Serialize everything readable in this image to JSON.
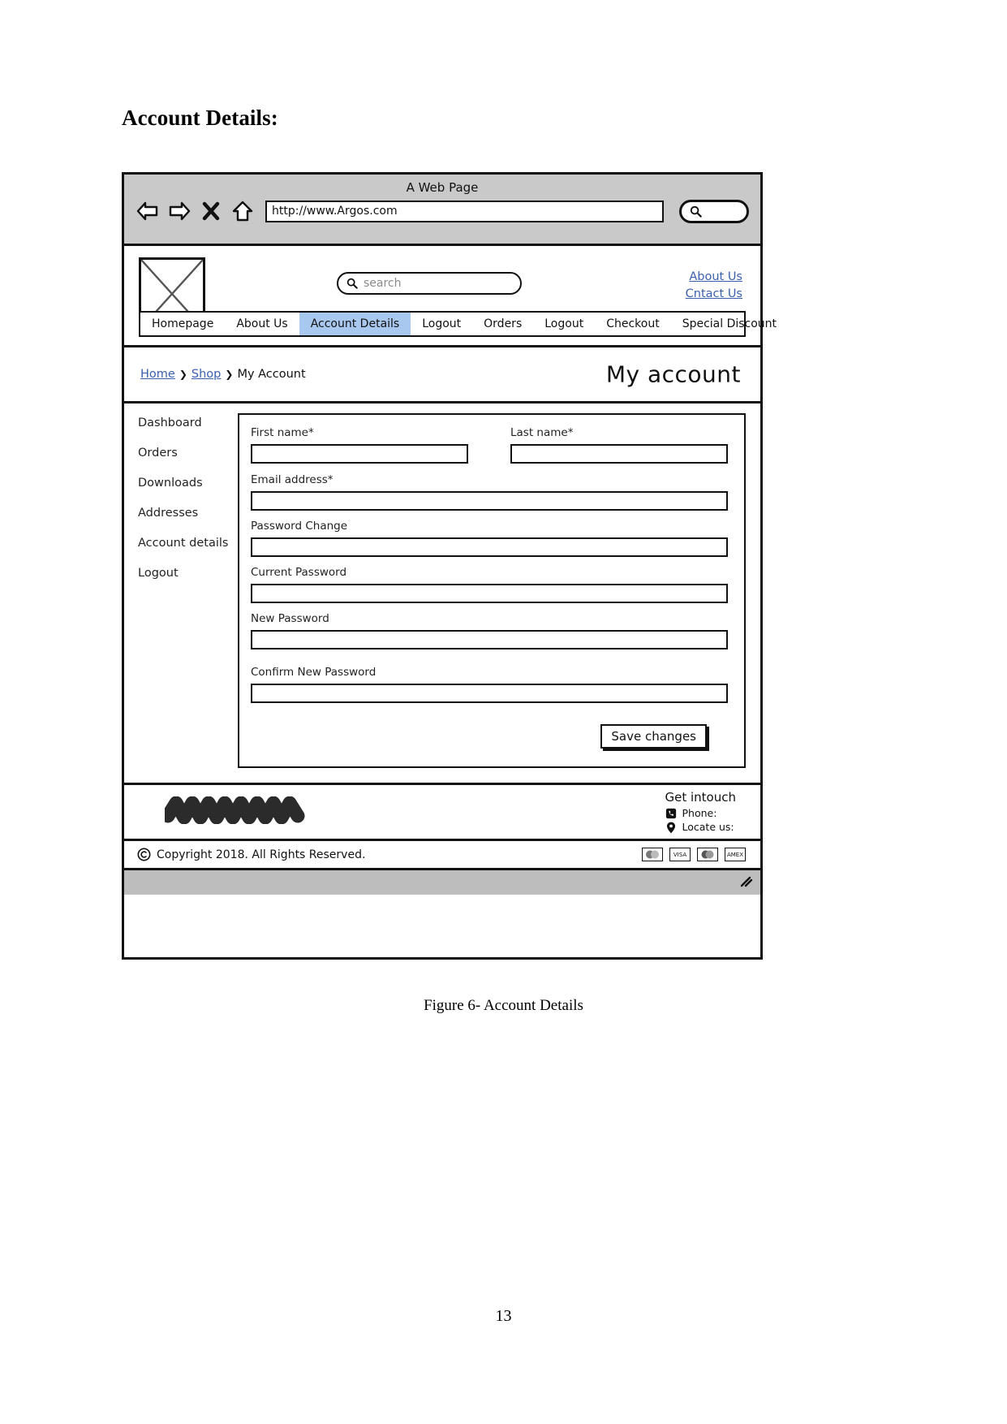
{
  "document": {
    "heading": "Account Details:",
    "figure_caption": "Figure 6- Account Details",
    "page_number": "13"
  },
  "browser": {
    "window_title": "A Web Page",
    "url": "http://www.Argos.com",
    "icons": {
      "back": "back-arrow-icon",
      "forward": "forward-arrow-icon",
      "stop": "close-x-icon",
      "home": "home-icon",
      "search": "search-icon"
    }
  },
  "site_header": {
    "logo_alt": "logo-placeholder",
    "search_placeholder": "search",
    "links": [
      {
        "label": "About Us"
      },
      {
        "label": "Cntact Us"
      }
    ]
  },
  "nav": {
    "items": [
      {
        "label": "Homepage",
        "active": false
      },
      {
        "label": "About Us",
        "active": false
      },
      {
        "label": "Account Details",
        "active": true
      },
      {
        "label": "Logout",
        "active": false
      },
      {
        "label": "Orders",
        "active": false
      },
      {
        "label": "Logout",
        "active": false
      },
      {
        "label": "Checkout",
        "active": false
      },
      {
        "label": "Special Discount",
        "active": false
      }
    ],
    "active_color": "#a8c8f0"
  },
  "breadcrumb": {
    "home": "Home",
    "shop": "Shop",
    "current": "My Account",
    "separator": "❯"
  },
  "page": {
    "title": "My account"
  },
  "sidebar": {
    "items": [
      {
        "label": "Dashboard"
      },
      {
        "label": "Orders"
      },
      {
        "label": "Downloads"
      },
      {
        "label": "Addresses"
      },
      {
        "label": "Account details"
      },
      {
        "label": "Logout"
      }
    ]
  },
  "form": {
    "first_name_label": "First name*",
    "first_name_value": "",
    "last_name_label": "Last name*",
    "last_name_value": "",
    "email_label": "Email address*",
    "email_value": "",
    "password_change_label": "Password Change",
    "password_change_value": "",
    "current_password_label": "Current Password",
    "current_password_value": "",
    "new_password_label": "New Password",
    "new_password_value": "",
    "confirm_password_label": "Confirm New Password",
    "confirm_password_value": "",
    "save_button": "Save changes"
  },
  "footer": {
    "get_in_touch": "Get intouch",
    "phone_label": "Phone:",
    "locate_label": "Locate us:",
    "copyright": "Copyright 2018. All Rights Reserved.",
    "copyright_symbol": "©",
    "payment_icons": [
      {
        "name": "maestro-card-icon",
        "label": ""
      },
      {
        "name": "visa-card-icon",
        "label": "VISA"
      },
      {
        "name": "mastercard-icon",
        "label": ""
      },
      {
        "name": "amex-card-icon",
        "label": "AMEX"
      }
    ]
  }
}
